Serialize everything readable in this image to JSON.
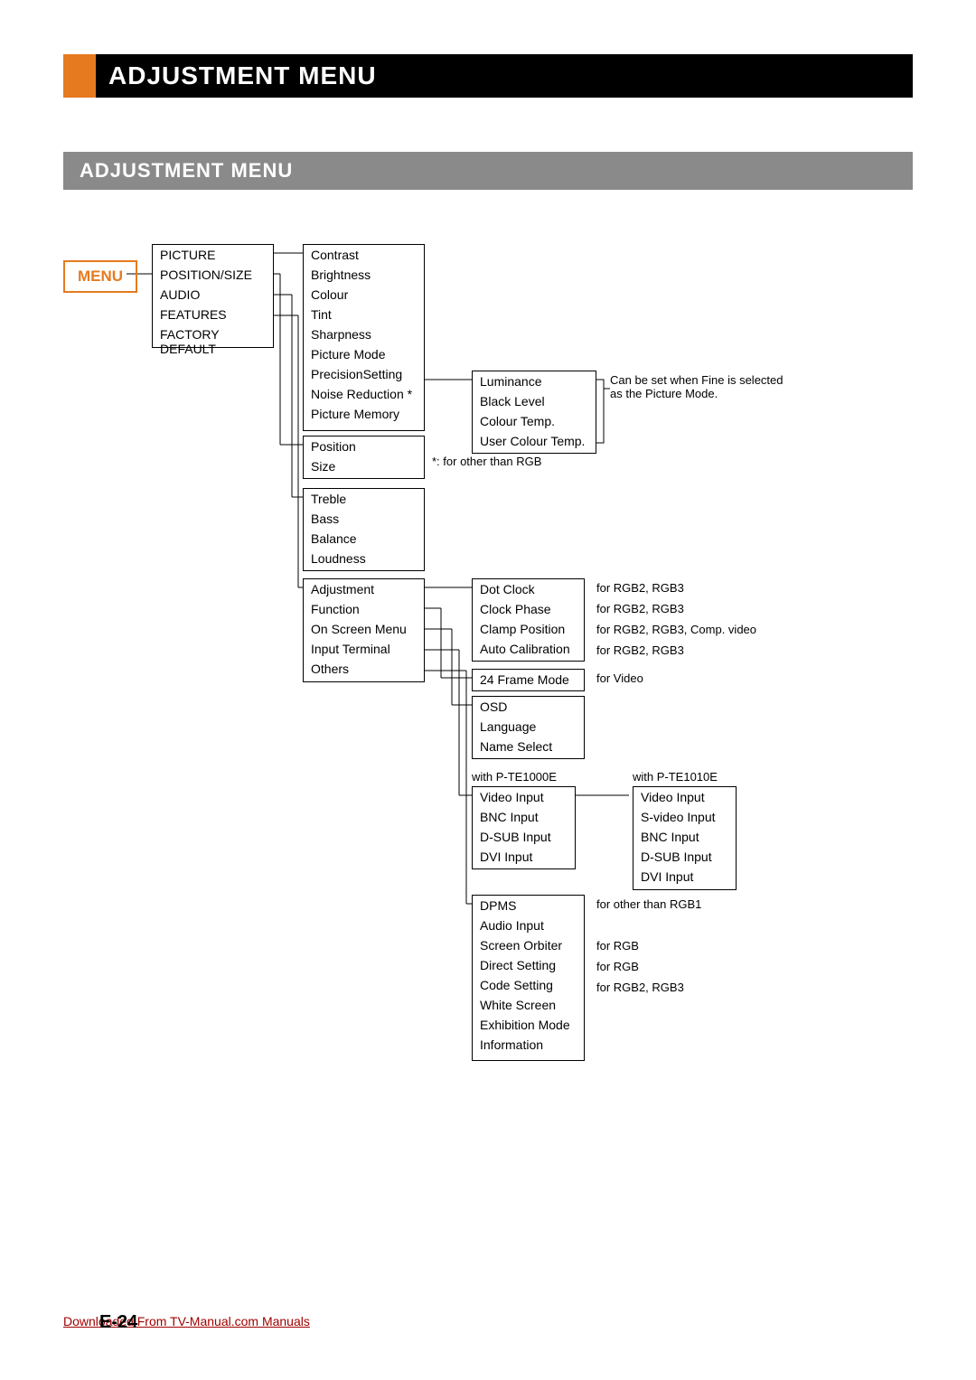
{
  "header": {
    "title": "ADJUSTMENT MENU",
    "subtitle": "ADJUSTMENT MENU"
  },
  "menu_label": "MENU",
  "col1": [
    "PICTURE",
    "POSITION/SIZE",
    "AUDIO",
    "FEATURES",
    "FACTORY DEFAULT"
  ],
  "col2_picture": [
    "Contrast",
    "Brightness",
    "Colour",
    "Tint",
    "Sharpness",
    "Picture Mode",
    "PrecisionSetting",
    "Noise Reduction *",
    "Picture Memory"
  ],
  "col2_position": [
    "Position",
    "Size"
  ],
  "col2_audio": [
    "Treble",
    "Bass",
    "Balance",
    "Loudness"
  ],
  "col2_features": [
    "Adjustment",
    "Function",
    "On Screen Menu",
    "Input Terminal",
    "Others"
  ],
  "precision": [
    "Luminance",
    "Black Level",
    "Colour Temp.",
    "User Colour Temp."
  ],
  "precision_note": "Can be set when Fine is selected as the Picture Mode.",
  "note_rgb": "*: for other than RGB",
  "adjustment": [
    {
      "item": "Dot Clock",
      "note": "for RGB2, RGB3"
    },
    {
      "item": "Clock Phase",
      "note": "for RGB2, RGB3"
    },
    {
      "item": "Clamp Position",
      "note": "for RGB2, RGB3, Comp. video"
    },
    {
      "item": "Auto Calibration",
      "note": "for RGB2, RGB3"
    }
  ],
  "function": [
    {
      "item": "24 Frame Mode",
      "note": "for Video"
    }
  ],
  "osd": [
    "OSD",
    "Language",
    "Name Select"
  ],
  "input1_label": "with P-TE1000E",
  "input1": [
    "Video Input",
    "BNC Input",
    "D-SUB Input",
    "DVI Input"
  ],
  "input2_label": "with P-TE1010E",
  "input2": [
    "Video Input",
    "S-video Input",
    "BNC Input",
    "D-SUB Input",
    "DVI Input"
  ],
  "others": [
    {
      "item": "DPMS",
      "note": "for other than RGB1"
    },
    {
      "item": "Audio Input",
      "note": ""
    },
    {
      "item": "Screen Orbiter",
      "note": "for RGB"
    },
    {
      "item": "Direct Setting",
      "note": "for RGB"
    },
    {
      "item": "Code Setting",
      "note": "for RGB2, RGB3"
    },
    {
      "item": "White Screen",
      "note": ""
    },
    {
      "item": "Exhibition Mode",
      "note": ""
    },
    {
      "item": "Information",
      "note": ""
    }
  ],
  "footer": {
    "link": "Downloaded From TV-Manual.com Manuals",
    "page": "E-24"
  }
}
